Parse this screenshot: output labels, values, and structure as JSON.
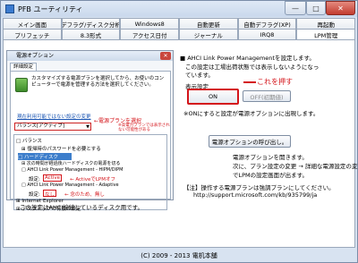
{
  "window": {
    "title": "PFB ユーティリティ",
    "minimize": "—",
    "maximize": "□",
    "close": "✕"
  },
  "tabs_row1": [
    {
      "label": "メイン画面"
    },
    {
      "label": "デフラグ/ディスク分析"
    },
    {
      "label": "Windows8"
    },
    {
      "label": "自動更新"
    },
    {
      "label": "自動デフラグ(XP)"
    },
    {
      "label": "再起動"
    }
  ],
  "tabs_row2": [
    {
      "label": "プリフェッチ"
    },
    {
      "label": "8.3形式"
    },
    {
      "label": "アクセス日付"
    },
    {
      "label": "ジャーナル"
    },
    {
      "label": "IRQ8"
    },
    {
      "label": "LPM管理"
    }
  ],
  "dialog": {
    "title": "電源オプション",
    "close": "✕",
    "tab": "詳細設定",
    "intro": "カスタマイズする電源プランを選択してから、お使いのコンピューターで電源を管理する方法を選択してください。",
    "link": "現在利用可能ではない設定の変更",
    "plan_value": "バランス[アクティブ]",
    "annot_plan": "←電源プランを選択",
    "annot_plan_small": "※高電力プランでは表示されない可能性がある",
    "tree": {
      "balance": "□ バランス",
      "password": "⊞ 復帰時のパスワードを必要とする",
      "harddisk": "□ ハードディスク",
      "hdd_off": "⊞ 次の時間が経過後ハードディスクの電源を切る",
      "ahci": "□ AHCI Link Power Management - HIPM/DIPM",
      "setting_label": "設定:",
      "setting_value": "Active",
      "annot_active": "← ActiveでLPMオフ",
      "adaptive": "□ AHCI Link Power Management - Adaptive",
      "setting2_label": "設定:",
      "setting2_value": "なし",
      "annot_none": "← 念のため、無し",
      "ie": "⊞ Internet Explorer",
      "desktop": "⊞ デスクトップの背景の設定"
    }
  },
  "note_under_dialog": "この設定はAHCI接続しているディスク用です。",
  "right": {
    "heading": "■ AHCI Link Power Managementを設定します。",
    "sub1": "この設定は工場出荷状態では表示しないようになっ",
    "sub2": "ています。",
    "label_display": "表示設定",
    "on_label": "ON",
    "off_label": "OFF(初期値)",
    "annot_on": "これを押す",
    "note_on": "※ONにすると設定が電源オプションに出現します。",
    "power_btn": "電源オプションの呼び出し。",
    "desc1": "電源オプションを開きます。",
    "desc2": "次に、プラン設定の変更 → 詳細な電源設定の変更",
    "desc3": "でLPMの設定画面が出ます。",
    "notice": "【注】操作する電源プランは強調プランにしてください。",
    "url": "http://support.microsoft.com/kb/935799/ja"
  },
  "status": "(C) 2009 - 2013  電机本舗"
}
